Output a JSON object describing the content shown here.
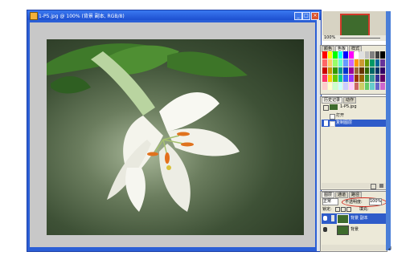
{
  "document": {
    "title": "1-P5.jpg @ 100% (背景 副本, RGB/8)",
    "min_label": "_",
    "max_label": "□",
    "close_label": "×"
  },
  "navigator": {
    "zoom": "100%"
  },
  "swatches": {
    "tabs": [
      "颜色",
      "色板",
      "样式"
    ],
    "colors": [
      "#ff0000",
      "#ffff00",
      "#00ff00",
      "#00ffff",
      "#0000ff",
      "#ff00ff",
      "#ffffff",
      "#e0e0e0",
      "#c0c0c0",
      "#808080",
      "#404040",
      "#000000",
      "#ff6666",
      "#ffcc66",
      "#99ff66",
      "#66ffcc",
      "#6699ff",
      "#cc66ff",
      "#ff9900",
      "#cc9933",
      "#669900",
      "#009966",
      "#006699",
      "#663399",
      "#cc0000",
      "#cc9900",
      "#339900",
      "#009999",
      "#0033cc",
      "#990099",
      "#996633",
      "#663300",
      "#336600",
      "#006666",
      "#003366",
      "#330066",
      "#ff3366",
      "#ffcc00",
      "#66cc00",
      "#00cc99",
      "#3366ff",
      "#9933ff",
      "#993300",
      "#996600",
      "#339933",
      "#339999",
      "#333399",
      "#660066",
      "#ffcccc",
      "#ffffcc",
      "#ccffcc",
      "#ccffff",
      "#ccccff",
      "#ffccff",
      "#cc6666",
      "#cccc66",
      "#66cc66",
      "#66cccc",
      "#6666cc",
      "#cc66cc"
    ]
  },
  "history": {
    "tabs": [
      "历史记录",
      "动作"
    ],
    "snapshot": "1-P5.jpg",
    "items": [
      "打开",
      "复制图层"
    ]
  },
  "layers": {
    "tabs": [
      "图层",
      "通道",
      "路径"
    ],
    "blend_mode": "正常",
    "opacity_label": "不透明度:",
    "opacity_value": "100%",
    "lock_label": "锁定:",
    "fill_label": "填充:",
    "items": [
      "背景 副本",
      "背景"
    ]
  },
  "colors": {
    "title_bar": "#1d4fd0",
    "selection": "#2e5bc9",
    "annotation_circle": "#d22a1f"
  }
}
